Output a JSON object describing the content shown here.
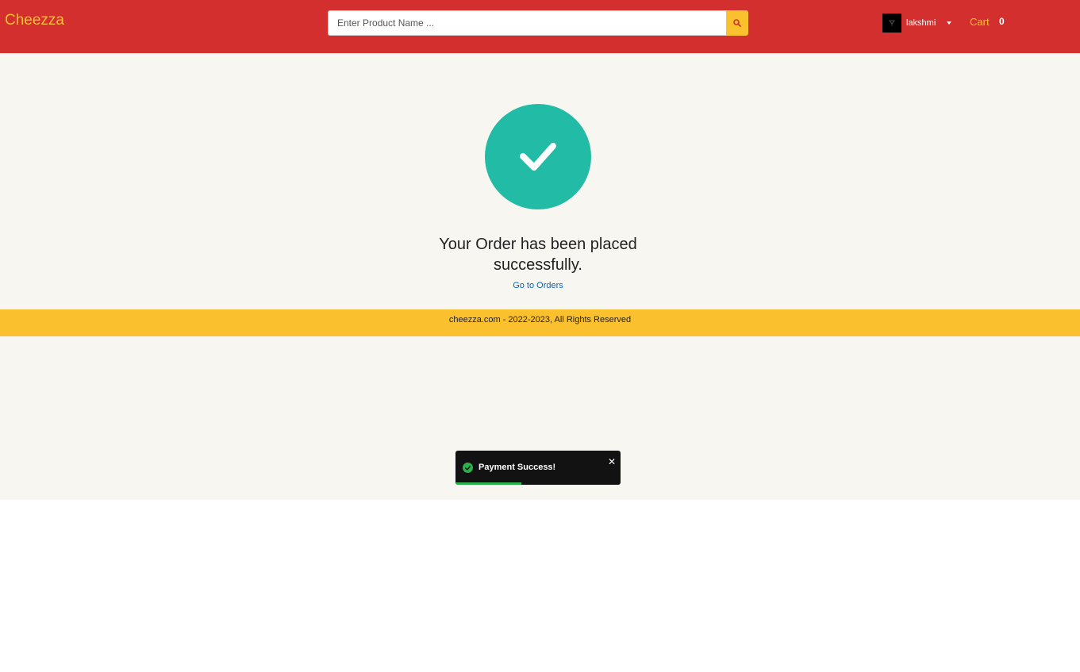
{
  "header": {
    "logo": "Cheezza",
    "search": {
      "placeholder": "Enter Product Name ..."
    },
    "user": {
      "name": "lakshmi"
    },
    "cart": {
      "label": "Cart",
      "count": "0"
    }
  },
  "main": {
    "message": "Your Order has been placed successfully.",
    "orders_link": "Go to Orders"
  },
  "footer": {
    "text": "cheezza.com - 2022-2023, All Rights Reserved"
  },
  "toast": {
    "message": "Payment Success!",
    "progress": 0.4
  },
  "colors": {
    "header_bg": "#d32f2f",
    "accent": "#fbc02d",
    "success": "#22bba5",
    "toast_green": "#2bb24c"
  },
  "icons": [
    "search-icon",
    "user-avatar-icon",
    "chevron-down-icon",
    "checkmark-icon",
    "check-circle-icon",
    "close-icon"
  ]
}
